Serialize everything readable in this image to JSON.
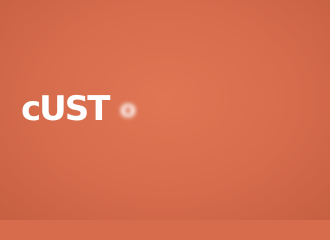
{
  "background_color": "#d66c4c",
  "text_color": "#ffffff",
  "wordmark": {
    "text": "custo",
    "sharp_part": "cUST",
    "motion_blurred_part": "o"
  }
}
